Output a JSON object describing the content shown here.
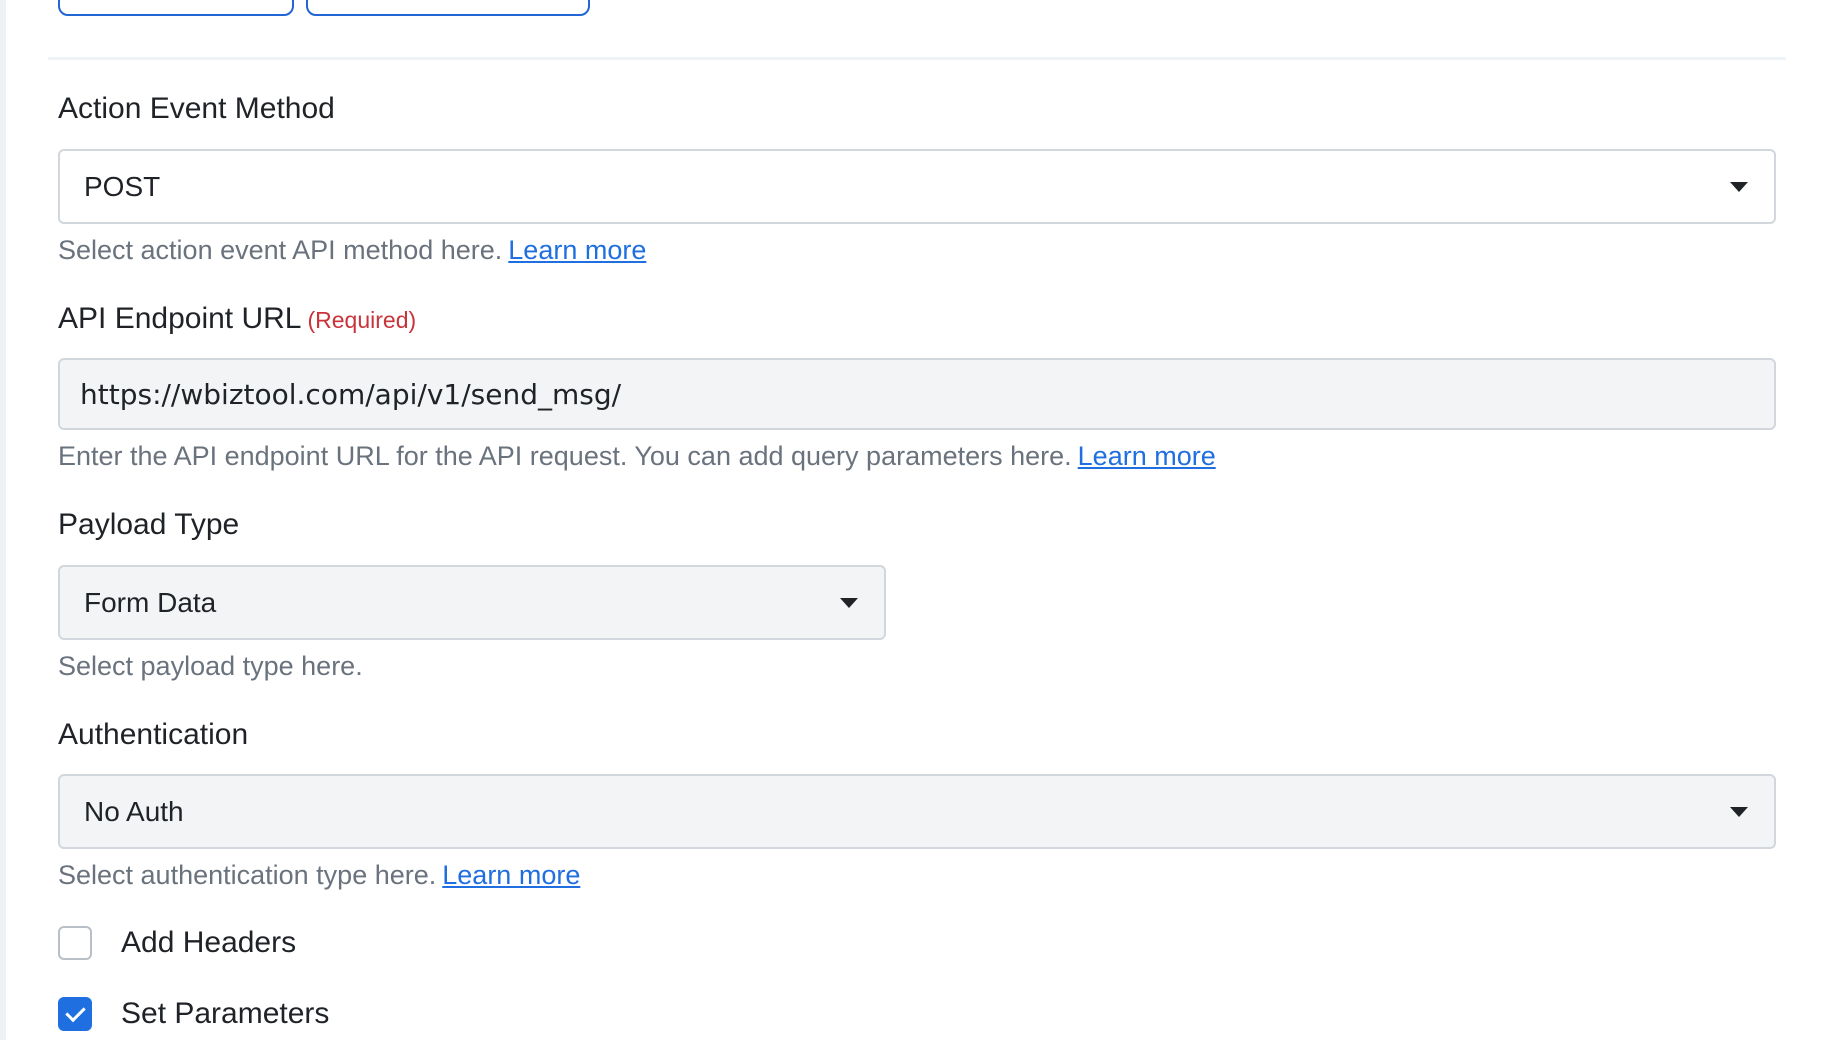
{
  "method": {
    "label": "Action Event Method",
    "value": "POST",
    "help": "Select action event API method here.",
    "link": "Learn more"
  },
  "endpoint": {
    "label": "API Endpoint URL",
    "required": "(Required)",
    "value": "https://wbiztool.com/api/v1/send_msg/",
    "help": "Enter the API endpoint URL for the API request. You can add query parameters here.",
    "link": "Learn more"
  },
  "payload": {
    "label": "Payload Type",
    "value": "Form Data",
    "help": "Select payload type here."
  },
  "auth": {
    "label": "Authentication",
    "value": "No Auth",
    "help": "Select authentication type here.",
    "link": "Learn more"
  },
  "options": [
    {
      "label": "Add Headers",
      "checked": false
    },
    {
      "label": "Set Parameters",
      "checked": true
    }
  ],
  "colors": {
    "accent": "#1f6fe0",
    "required": "#c9343b",
    "help_text": "#6a737d"
  }
}
